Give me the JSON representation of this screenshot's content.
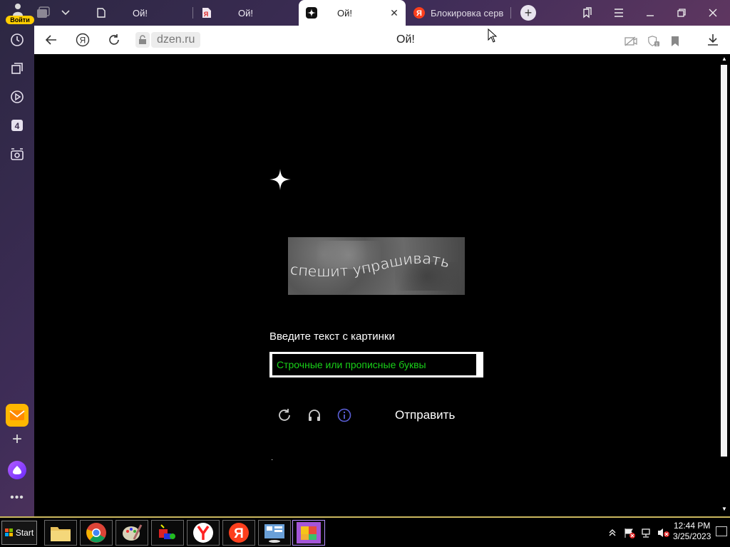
{
  "sidebar": {
    "login_label": "Войти"
  },
  "tabs": [
    {
      "title": "Ой!"
    },
    {
      "title": "Ой!"
    },
    {
      "title": "Ой!"
    },
    {
      "title": "Блокировка серв"
    }
  ],
  "toolbar": {
    "domain": "dzen.ru",
    "page_title": "Ой!"
  },
  "page": {
    "captcha_text": "спешит упрашивать",
    "prompt": "Введите текст с картинки",
    "input_placeholder": "Строчные или прописные буквы",
    "submit_label": "Отправить",
    "dot": "·"
  },
  "taskbar": {
    "start_label": "Start",
    "time": "12:44 PM",
    "date": "3/25/2023"
  },
  "colors": {
    "accent": "#ffcc00",
    "placeholder_green": "#19d119",
    "info_blue": "#5a5fd6"
  }
}
